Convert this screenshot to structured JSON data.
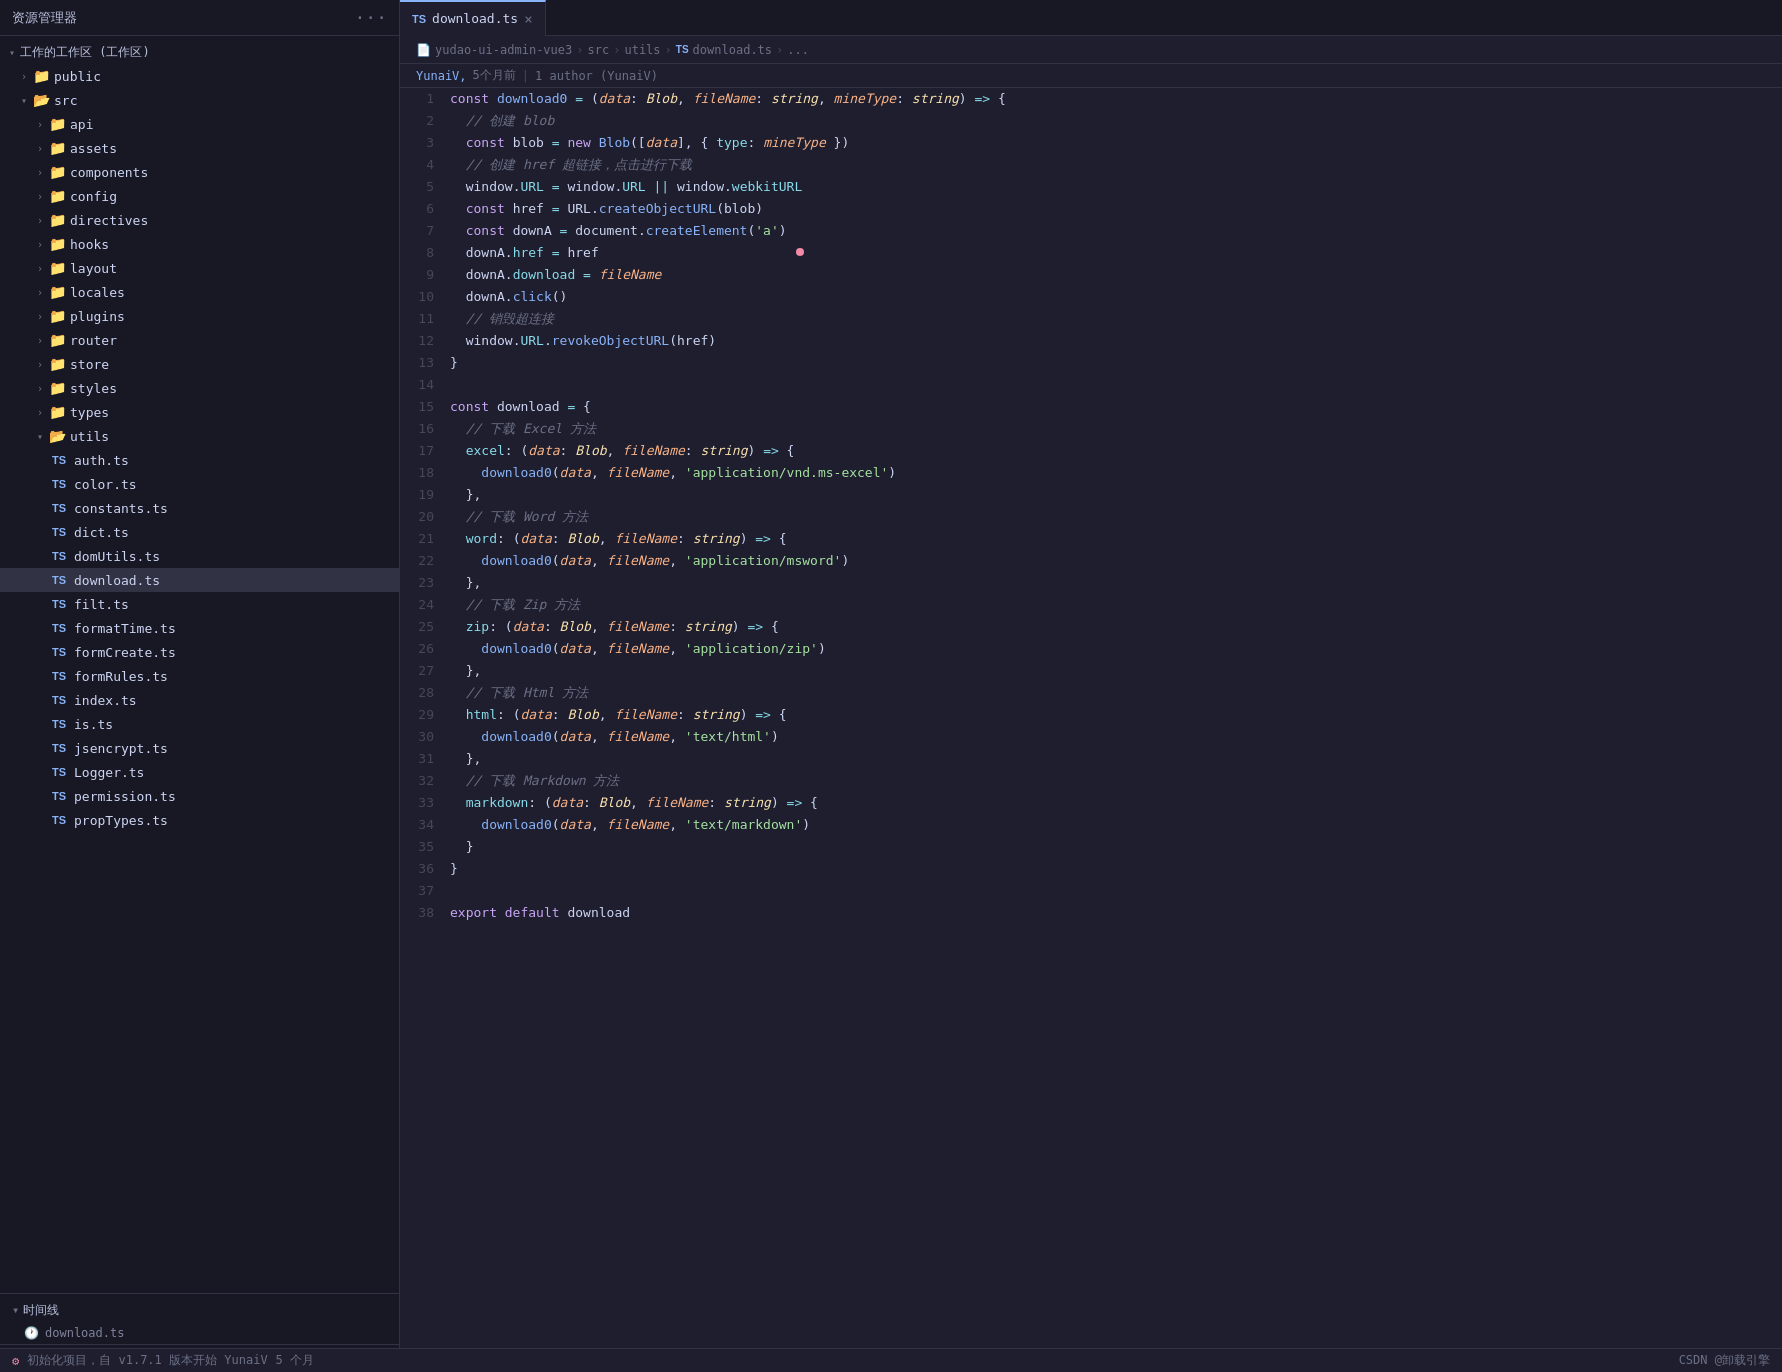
{
  "sidebar": {
    "title": "资源管理器",
    "workspace_label": "工作的工作区 (工作区)",
    "dots_label": "···",
    "items": [
      {
        "id": "public",
        "label": "public",
        "type": "folder",
        "level": 1,
        "expanded": false,
        "icon": "folder"
      },
      {
        "id": "src",
        "label": "src",
        "type": "folder",
        "level": 1,
        "expanded": true,
        "icon": "src"
      },
      {
        "id": "api",
        "label": "api",
        "type": "folder",
        "level": 2,
        "expanded": false,
        "icon": "api"
      },
      {
        "id": "assets",
        "label": "assets",
        "type": "folder",
        "level": 2,
        "expanded": false,
        "icon": "assets"
      },
      {
        "id": "components",
        "label": "components",
        "type": "folder",
        "level": 2,
        "expanded": false,
        "icon": "components"
      },
      {
        "id": "config",
        "label": "config",
        "type": "folder",
        "level": 2,
        "expanded": false,
        "icon": "config"
      },
      {
        "id": "directives",
        "label": "directives",
        "type": "folder",
        "level": 2,
        "expanded": false,
        "icon": "directives"
      },
      {
        "id": "hooks",
        "label": "hooks",
        "type": "folder",
        "level": 2,
        "expanded": false,
        "icon": "hooks"
      },
      {
        "id": "layout",
        "label": "layout",
        "type": "folder",
        "level": 2,
        "expanded": false,
        "icon": "layout"
      },
      {
        "id": "locales",
        "label": "locales",
        "type": "folder",
        "level": 2,
        "expanded": false,
        "icon": "locales"
      },
      {
        "id": "plugins",
        "label": "plugins",
        "type": "folder",
        "level": 2,
        "expanded": false,
        "icon": "plugins"
      },
      {
        "id": "router",
        "label": "router",
        "type": "folder",
        "level": 2,
        "expanded": false,
        "icon": "router"
      },
      {
        "id": "store",
        "label": "store",
        "type": "folder",
        "level": 2,
        "expanded": false,
        "icon": "store"
      },
      {
        "id": "styles",
        "label": "styles",
        "type": "folder",
        "level": 2,
        "expanded": false,
        "icon": "styles"
      },
      {
        "id": "types",
        "label": "types",
        "type": "folder",
        "level": 2,
        "expanded": false,
        "icon": "types"
      },
      {
        "id": "utils",
        "label": "utils",
        "type": "folder",
        "level": 2,
        "expanded": true,
        "icon": "utils"
      },
      {
        "id": "auth.ts",
        "label": "auth.ts",
        "type": "ts",
        "level": 3
      },
      {
        "id": "color.ts",
        "label": "color.ts",
        "type": "ts",
        "level": 3
      },
      {
        "id": "constants.ts",
        "label": "constants.ts",
        "type": "ts",
        "level": 3
      },
      {
        "id": "dict.ts",
        "label": "dict.ts",
        "type": "ts",
        "level": 3
      },
      {
        "id": "domUtils.ts",
        "label": "domUtils.ts",
        "type": "ts",
        "level": 3
      },
      {
        "id": "download.ts",
        "label": "download.ts",
        "type": "ts",
        "level": 3,
        "active": true
      },
      {
        "id": "filt.ts",
        "label": "filt.ts",
        "type": "ts",
        "level": 3
      },
      {
        "id": "formatTime.ts",
        "label": "formatTime.ts",
        "type": "ts",
        "level": 3
      },
      {
        "id": "formCreate.ts",
        "label": "formCreate.ts",
        "type": "ts",
        "level": 3
      },
      {
        "id": "formRules.ts",
        "label": "formRules.ts",
        "type": "ts",
        "level": 3
      },
      {
        "id": "index.ts",
        "label": "index.ts",
        "type": "ts",
        "level": 3
      },
      {
        "id": "is.ts",
        "label": "is.ts",
        "type": "ts",
        "level": 3
      },
      {
        "id": "jsencrypt.ts",
        "label": "jsencrypt.ts",
        "type": "ts",
        "level": 3
      },
      {
        "id": "Logger.ts",
        "label": "Logger.ts",
        "type": "ts",
        "level": 3
      },
      {
        "id": "permission.ts",
        "label": "permission.ts",
        "type": "ts",
        "level": 3
      },
      {
        "id": "propTypes.ts",
        "label": "propTypes.ts",
        "type": "ts",
        "level": 3
      }
    ],
    "timeline": {
      "label": "时间线",
      "items": [
        {
          "label": "download.ts"
        }
      ]
    },
    "git_commit": {
      "icon": "git-icon",
      "label": "初始化项目，自 v1.7.1 版本开始",
      "author": "YunaiV",
      "time": "5 个月"
    }
  },
  "tab_bar": {
    "active_tab": {
      "ts_label": "TS",
      "filename": "download.ts",
      "close_label": "×"
    }
  },
  "breadcrumb": {
    "parts": [
      "yudao-ui-admin-vue3",
      "src",
      "utils",
      "download.ts",
      "..."
    ],
    "ts_label": "TS",
    "sep": "›"
  },
  "git_blame": {
    "author": "YunaiV,",
    "time": "5个月前",
    "sep": "|",
    "author_count": "1 author (YunaiV)"
  },
  "statusbar": {
    "left": "初始化项目，自 v1.7.1 版本开始  YunaiV",
    "right_time": "5 个月",
    "brand": "CSDN @卸载引擎"
  },
  "colors": {
    "bg": "#1e1e2e",
    "sidebar_bg": "#181825",
    "active_line": "#313244",
    "accent": "#89b4fa"
  },
  "code_lines": [
    {
      "num": 1,
      "html": "<span class='kw'>const</span> <span class='fn'>download0</span> <span class='op'>=</span> <span class='punc'>(</span><span class='param'>data</span><span class='punc'>:</span> <span class='type'>Blob</span><span class='punc'>,</span> <span class='param'>fileName</span><span class='punc'>:</span> <span class='type'>string</span><span class='punc'>,</span> <span class='param'>mineType</span><span class='punc'>:</span> <span class='type'>string</span><span class='punc'>)</span> <span class='op'>=></span> <span class='punc'>{</span>"
    },
    {
      "num": 2,
      "html": "  <span class='comment'>// 创建 blob</span>"
    },
    {
      "num": 3,
      "html": "  <span class='kw'>const</span> <span class='var'>blob</span> <span class='op'>=</span> <span class='kw'>new</span> <span class='fn'>Blob</span><span class='punc'>([</span><span class='param'>data</span><span class='punc'>],</span> <span class='punc'>{</span> <span class='prop'>type</span><span class='punc'>:</span> <span class='param'>mineType</span> <span class='punc'>})</span>"
    },
    {
      "num": 4,
      "html": "  <span class='comment'>// 创建 href 超链接，点击进行下载</span>"
    },
    {
      "num": 5,
      "html": "  <span class='var'>window</span><span class='punc'>.</span><span class='prop'>URL</span> <span class='op'>=</span> <span class='var'>window</span><span class='punc'>.</span><span class='prop'>URL</span> <span class='op'>||</span> <span class='var'>window</span><span class='punc'>.</span><span class='prop'>webkitURL</span>"
    },
    {
      "num": 6,
      "html": "  <span class='kw'>const</span> <span class='var'>href</span> <span class='op'>=</span> <span class='var'>URL</span><span class='punc'>.</span><span class='method'>createObjectURL</span><span class='punc'>(</span><span class='var'>blob</span><span class='punc'>)</span>"
    },
    {
      "num": 7,
      "html": "  <span class='kw'>const</span> <span class='var'>downA</span> <span class='op'>=</span> <span class='var'>document</span><span class='punc'>.</span><span class='method'>createElement</span><span class='punc'>(</span><span class='str'>'a'</span><span class='punc'>)</span>"
    },
    {
      "num": 8,
      "html": "  <span class='var'>downA</span><span class='punc'>.</span><span class='prop'>href</span> <span class='op'>=</span> <span class='var'>href</span>",
      "dot": true
    },
    {
      "num": 9,
      "html": "  <span class='var'>downA</span><span class='punc'>.</span><span class='prop'>download</span> <span class='op'>=</span> <span class='param'>fileName</span>"
    },
    {
      "num": 10,
      "html": "  <span class='var'>downA</span><span class='punc'>.</span><span class='method'>click</span><span class='punc'>()"
    },
    {
      "num": 11,
      "html": "  <span class='comment'>// 销毁超连接</span>"
    },
    {
      "num": 12,
      "html": "  <span class='var'>window</span><span class='punc'>.</span><span class='prop'>URL</span><span class='punc'>.</span><span class='method'>revokeObjectURL</span><span class='punc'>(</span><span class='var'>href</span><span class='punc'>)</span>"
    },
    {
      "num": 13,
      "html": "<span class='punc'>}</span>"
    },
    {
      "num": 14,
      "html": ""
    },
    {
      "num": 15,
      "html": "<span class='kw'>const</span> <span class='var'>download</span> <span class='op'>=</span> <span class='punc'>{</span>"
    },
    {
      "num": 16,
      "html": "  <span class='comment'>// 下载 Excel 方法</span>"
    },
    {
      "num": 17,
      "html": "  <span class='prop'>excel</span><span class='punc'>:</span> <span class='punc'>(</span><span class='param'>data</span><span class='punc'>:</span> <span class='type'>Blob</span><span class='punc'>,</span> <span class='param'>fileName</span><span class='punc'>:</span> <span class='type'>string</span><span class='punc'>)</span> <span class='op'>=></span> <span class='punc'>{</span>"
    },
    {
      "num": 18,
      "html": "    <span class='fn'>download0</span><span class='punc'>(</span><span class='param'>data</span><span class='punc'>,</span> <span class='param'>fileName</span><span class='punc'>,</span> <span class='str'>'application/vnd.ms-excel'</span><span class='punc'>)</span>"
    },
    {
      "num": 19,
      "html": "  <span class='punc'>},</span>"
    },
    {
      "num": 20,
      "html": "  <span class='comment'>// 下载 Word 方法</span>"
    },
    {
      "num": 21,
      "html": "  <span class='prop'>word</span><span class='punc'>:</span> <span class='punc'>(</span><span class='param'>data</span><span class='punc'>:</span> <span class='type'>Blob</span><span class='punc'>,</span> <span class='param'>fileName</span><span class='punc'>:</span> <span class='type'>string</span><span class='punc'>)</span> <span class='op'>=></span> <span class='punc'>{</span>"
    },
    {
      "num": 22,
      "html": "    <span class='fn'>download0</span><span class='punc'>(</span><span class='param'>data</span><span class='punc'>,</span> <span class='param'>fileName</span><span class='punc'>,</span> <span class='str'>'application/msword'</span><span class='punc'>)</span>"
    },
    {
      "num": 23,
      "html": "  <span class='punc'>},</span>"
    },
    {
      "num": 24,
      "html": "  <span class='comment'>// 下载 Zip 方法</span>"
    },
    {
      "num": 25,
      "html": "  <span class='prop'>zip</span><span class='punc'>:</span> <span class='punc'>(</span><span class='param'>data</span><span class='punc'>:</span> <span class='type'>Blob</span><span class='punc'>,</span> <span class='param'>fileName</span><span class='punc'>:</span> <span class='type'>string</span><span class='punc'>)</span> <span class='op'>=></span> <span class='punc'>{</span>"
    },
    {
      "num": 26,
      "html": "    <span class='fn'>download0</span><span class='punc'>(</span><span class='param'>data</span><span class='punc'>,</span> <span class='param'>fileName</span><span class='punc'>,</span> <span class='str'>'application/zip'</span><span class='punc'>)</span>"
    },
    {
      "num": 27,
      "html": "  <span class='punc'>},</span>"
    },
    {
      "num": 28,
      "html": "  <span class='comment'>// 下载 Html 方法</span>"
    },
    {
      "num": 29,
      "html": "  <span class='prop'>html</span><span class='punc'>:</span> <span class='punc'>(</span><span class='param'>data</span><span class='punc'>:</span> <span class='type'>Blob</span><span class='punc'>,</span> <span class='param'>fileName</span><span class='punc'>:</span> <span class='type'>string</span><span class='punc'>)</span> <span class='op'>=></span> <span class='punc'>{</span>"
    },
    {
      "num": 30,
      "html": "    <span class='fn'>download0</span><span class='punc'>(</span><span class='param'>data</span><span class='punc'>,</span> <span class='param'>fileName</span><span class='punc'>,</span> <span class='str'>'text/html'</span><span class='punc'>)</span>"
    },
    {
      "num": 31,
      "html": "  <span class='punc'>},</span>"
    },
    {
      "num": 32,
      "html": "  <span class='comment'>// 下载 Markdown 方法</span>"
    },
    {
      "num": 33,
      "html": "  <span class='prop'>markdown</span><span class='punc'>:</span> <span class='punc'>(</span><span class='param'>data</span><span class='punc'>:</span> <span class='type'>Blob</span><span class='punc'>,</span> <span class='param'>fileName</span><span class='punc'>:</span> <span class='type'>string</span><span class='punc'>)</span> <span class='op'>=></span> <span class='punc'>{</span>"
    },
    {
      "num": 34,
      "html": "    <span class='fn'>download0</span><span class='punc'>(</span><span class='param'>data</span><span class='punc'>,</span> <span class='param'>fileName</span><span class='punc'>,</span> <span class='str'>'text/markdown'</span><span class='punc'>)</span>"
    },
    {
      "num": 35,
      "html": "  <span class='punc'>}</span>"
    },
    {
      "num": 36,
      "html": "<span class='punc'>}</span>"
    },
    {
      "num": 37,
      "html": ""
    },
    {
      "num": 38,
      "html": "<span class='kw'>export</span> <span class='kw'>default</span> <span class='var'>download</span>"
    }
  ]
}
